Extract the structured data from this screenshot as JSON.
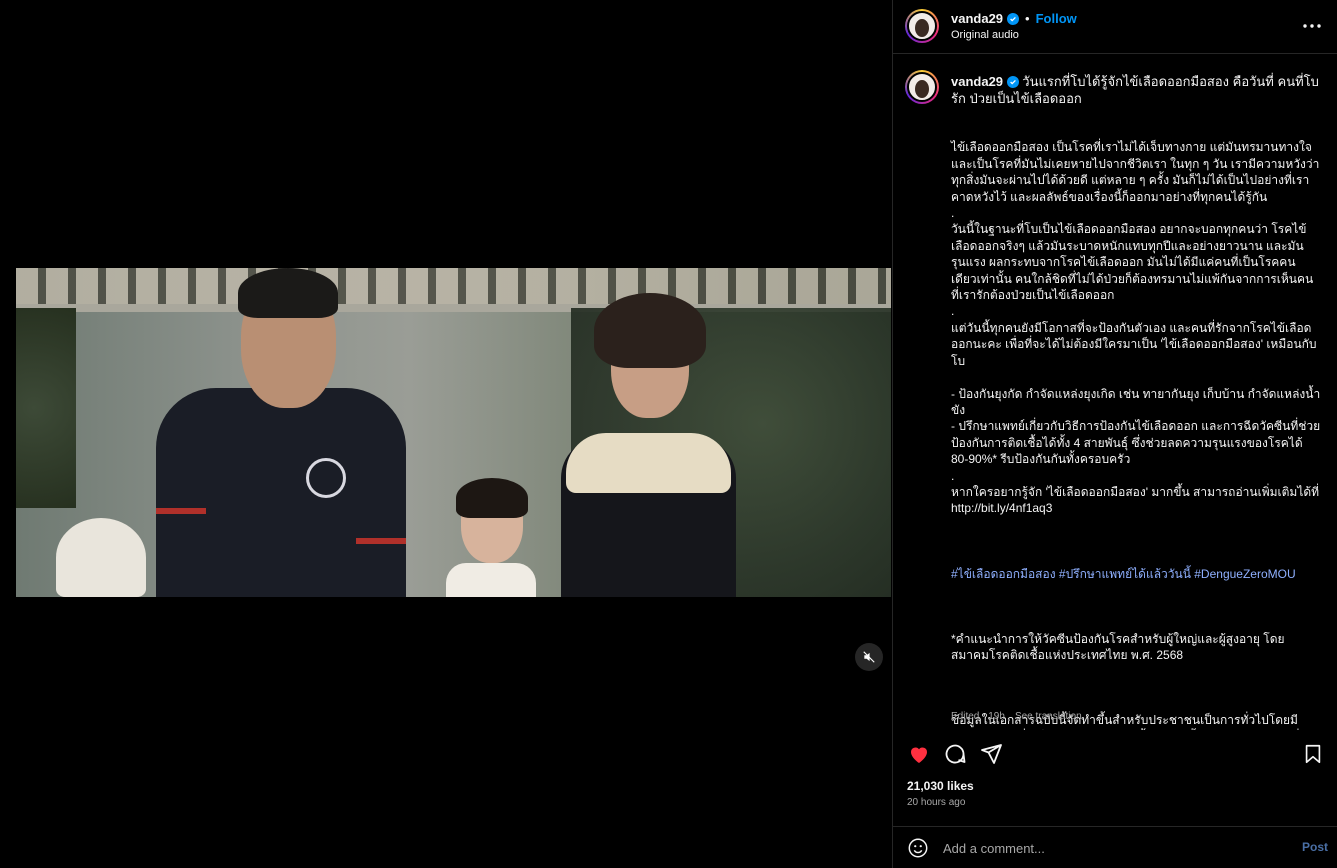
{
  "post": {
    "username": "vanda29",
    "follow_label": "Follow",
    "separator": "•",
    "audio": "Original audio"
  },
  "caption": {
    "username": "vanda29",
    "headline": "วันแรกที่โบได้รู้จักไข้เลือดออกมือสอง คือวันที่ คนที่โบรัก ป่วยเป็นไข้เลือดออก",
    "body": "ไข้เลือดออกมือสอง เป็นโรคที่เราไม่ได้เจ็บทางกาย แต่มันทรมานทางใจ และเป็นโรคที่มันไม่เคยหายไปจากชีวิตเรา ในทุก ๆ วัน เรามีความหวังว่าทุกสิ่งมันจะผ่านไปได้ด้วยดี แต่หลาย ๆ ครั้ง มันก็ไม่ได้เป็นไปอย่างที่เราคาดหวังไว้ และผลลัพธ์ของเรื่องนี้ก็ออกมาอย่างที่ทุกคนได้รู้กัน\n.\nวันนี้ในฐานะที่โบเป็นไข้เลือดออกมือสอง อยากจะบอกทุกคนว่า โรคไข้เลือดออกจริงๆ แล้วมันระบาดหนักแทบทุกปีและอย่างยาวนาน และมันรุนแรง ผลกระทบจากโรคไข้เลือดออก มันไม่ได้มีแค่คนที่เป็นโรคคนเดียวเท่านั้น คนใกล้ชิดที่ไม่ได้ป่วยก็ต้องทรมานไม่แพ้กันจากการเห็นคนที่เรารักต้องป่วยเป็นไข้เลือดออก\n.\nแต่วันนี้ทุกคนยังมีโอกาสที่จะป้องกันตัวเอง และคนที่รักจากโรคไข้เลือดออกนะคะ เพื่อที่จะได้ไม่ต้องมีใครมาเป็น 'ไข้เลือดออกมือสอง' เหมือนกับโบ\n\n- ป้องกันยุงกัด กำจัดแหล่งยุงเกิด เช่น ทายากันยุง เก็บบ้าน กำจัดแหล่งน้ำขัง\n- ปรึกษาแพทย์เกี่ยวกับวิธีการป้องกันไข้เลือดออก และการฉีดวัคซีนที่ช่วยป้องกันการติดเชื้อได้ทั้ง 4 สายพันธุ์ ซึ่งช่วยลดความรุนแรงของโรคได้ 80-90%* รีบป้องกันกันทั้งครอบครัว\n.\nหากใครอยากรู้จัก 'ไข้เลือดออกมือสอง' มากขึ้น สามารถอ่านเพิ่มเติมได้ที่ http://bit.ly/4nf1aq3",
    "hashtags": "#ไข้เลือดออกมือสอง #ปรึกษาแพทย์ได้แล้ววันนี้ #DengueZeroMOU",
    "note": "*คำแนะนำการให้วัคซีนป้องกันโรคสำหรับผู้ใหญ่และผู้สูงอายุ โดย สมาคมโรคติดเชื้อแห่งประเทศไทย พ.ศ. 2568",
    "disclaimer": "ข้อมูลในเอกสารฉบับนี้จัดทำขึ้นสำหรับประชาชนเป็นการทั่วไปโดยมีวัตถุประสงค์เพื่อเป็นการให้ข้อมูลเท่านั้น ข้อมูลนี้ไม่ควรถูกนำไปใช้เพื่อวินิจฉัยหรือรักษาปัญหาสุขภาพหรือโรคใด ๆ การให้ข้อมูลดังกล่าวนี้ไม่มีวัตถุประสงค์เป็นการทดแทนการปรึกษากับผู้ให้บริการทางการแพทย์ โปรดปรึกษาผู้ให้บริการทางการแพทย์ของท่านสำหรับคำแนะนำเพิ่มเติม ประสบการณ์ของแต่ละบุคคลเกี่ยวกับไข้เลือดออกอาจแตกต่างกันออกไป C-ANPROM/TH/DENV/0935: Jun 2025",
    "edited": "Edited · 19h",
    "see_translation": "See translation"
  },
  "stats": {
    "likes": "21,030 likes",
    "time_ago": "20 hours ago"
  },
  "comment": {
    "placeholder": "Add a comment...",
    "post_label": "Post"
  },
  "colors": {
    "accent": "#0095f6",
    "like": "#ff3040",
    "background": "#000000",
    "border": "#262626"
  }
}
